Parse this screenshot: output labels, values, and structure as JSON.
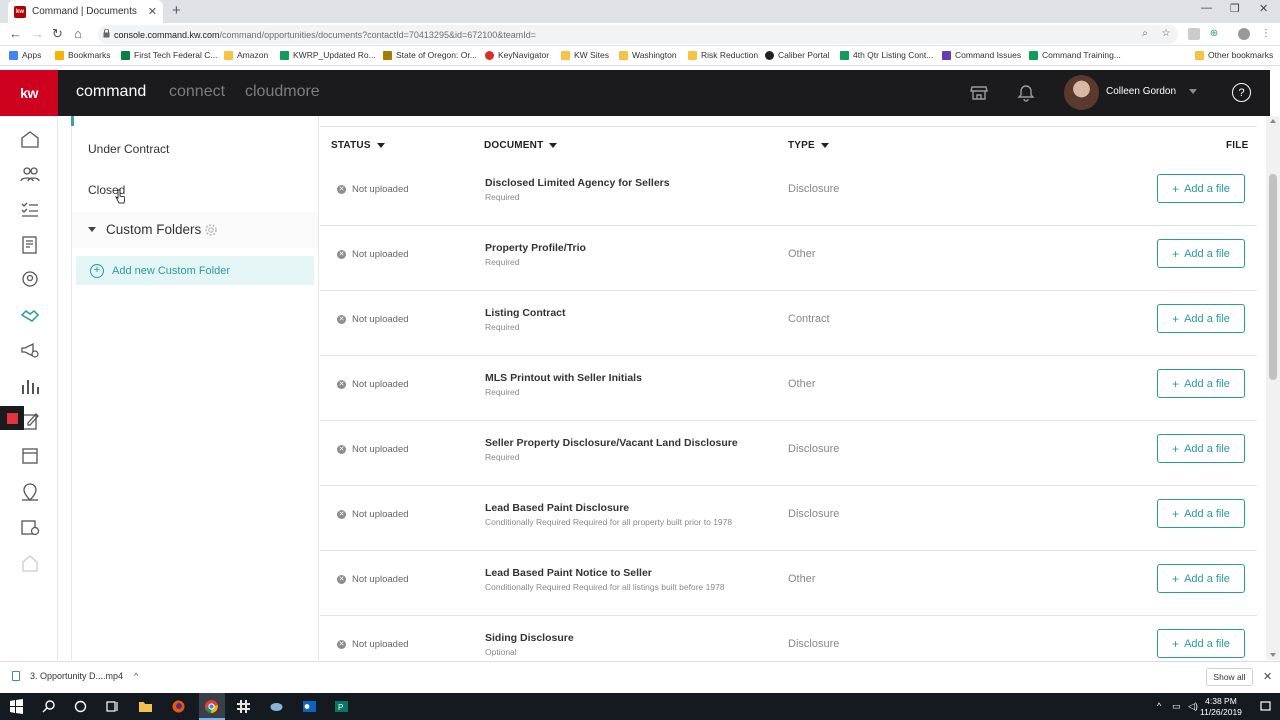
{
  "browser": {
    "tab_title": "Command | Documents",
    "favicon_text": "kw",
    "url_host": "console.command.kw.com",
    "url_path": "/command/opportunities/documents?contactId=70413295&id=672100&teamId=",
    "bookmarks": [
      {
        "label": "Apps",
        "color": "#4285f4"
      },
      {
        "label": "Bookmarks",
        "color": "#f4b400"
      },
      {
        "label": "First Tech Federal C...",
        "color": "#0b8043"
      },
      {
        "label": "Amazon",
        "color": "#f6c343"
      },
      {
        "label": "KWRP_Updated Ro...",
        "color": "#0f9d58"
      },
      {
        "label": "State of Oregon: Or...",
        "color": "#a67c00"
      },
      {
        "label": "KeyNavigator",
        "color": "#d93025"
      },
      {
        "label": "KW Sites",
        "color": "#f6c343"
      },
      {
        "label": "Washington",
        "color": "#f6c343"
      },
      {
        "label": "Risk Reduction",
        "color": "#f6c343"
      },
      {
        "label": "Caliber Portal",
        "color": "#222222"
      },
      {
        "label": "4th Qtr Listing Cont...",
        "color": "#0f9d58"
      },
      {
        "label": "Command Issues",
        "color": "#673ab7"
      },
      {
        "label": "Command Training...",
        "color": "#0f9d58"
      }
    ],
    "other_bookmarks": "Other bookmarks"
  },
  "header": {
    "logo": "kw",
    "nav": [
      "command",
      "connect",
      "cloudmore"
    ],
    "username": "Colleen Gordon",
    "help": "?"
  },
  "folders": {
    "items": [
      "Under Contract",
      "Closed"
    ],
    "custom_folders_label": "Custom Folders",
    "add_custom_folder": "Add new Custom Folder"
  },
  "table": {
    "headers": {
      "status": "STATUS",
      "document": "DOCUMENT",
      "type": "TYPE",
      "file": "FILE"
    },
    "add_label": "Add a file",
    "rows": [
      {
        "status": "Not uploaded",
        "name": "Disclosed Limited Agency for Sellers",
        "requirement": "Required",
        "type": "Disclosure"
      },
      {
        "status": "Not uploaded",
        "name": "Property Profile/Trio",
        "requirement": "Required",
        "type": "Other"
      },
      {
        "status": "Not uploaded",
        "name": "Listing Contract",
        "requirement": "Required",
        "type": "Contract"
      },
      {
        "status": "Not uploaded",
        "name": "MLS Printout with Seller Initials",
        "requirement": "Required",
        "type": "Other"
      },
      {
        "status": "Not uploaded",
        "name": "Seller Property Disclosure/Vacant Land Disclosure",
        "requirement": "Required",
        "type": "Disclosure"
      },
      {
        "status": "Not uploaded",
        "name": "Lead Based Paint Disclosure",
        "requirement": "Conditionally Required Required for all property built prior to 1978",
        "type": "Disclosure"
      },
      {
        "status": "Not uploaded",
        "name": "Lead Based Paint Notice to Seller",
        "requirement": "Conditionally Required Required for all listings built before 1978",
        "type": "Other"
      },
      {
        "status": "Not uploaded",
        "name": "Siding Disclosure",
        "requirement": "Optional",
        "type": "Disclosure"
      }
    ]
  },
  "downloads": {
    "file": "3. Opportunity D....mp4",
    "show_all": "Show all"
  },
  "taskbar": {
    "time": "4:38 PM",
    "date": "11/26/2019"
  },
  "colors": {
    "kw_red": "#ce011f",
    "header_bg": "#1b1b1d",
    "accent_teal": "#2b9a9d"
  }
}
